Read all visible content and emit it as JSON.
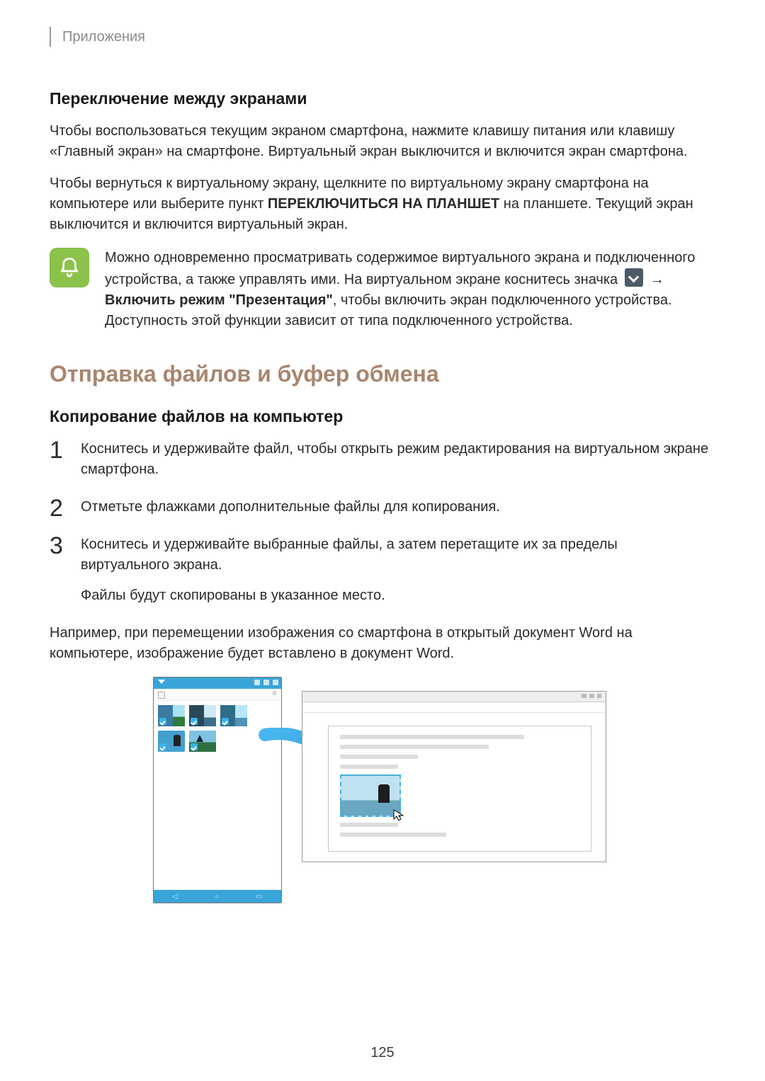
{
  "header": {
    "label": "Приложения"
  },
  "section1": {
    "title": "Переключение между экранами",
    "p1": "Чтобы воспользоваться текущим экраном смартфона, нажмите клавишу питания или клавишу «Главный экран» на смартфоне. Виртуальный экран выключится и включится экран смартфона.",
    "p2_a": "Чтобы вернуться к виртуальному экрану, щелкните по виртуальному экрану смартфона на компьютере или выберите пункт ",
    "p2_bold": "ПЕРЕКЛЮЧИТЬСЯ НА ПЛАНШЕТ",
    "p2_b": " на планшете. Текущий экран выключится и включится виртуальный экран."
  },
  "note": {
    "line1_a": "Можно одновременно просматривать содержимое виртуального экрана и подключенного устройства, а также управлять ими. На виртуальном экране коснитесь значка ",
    "line1_arrow": "→",
    "line2_bold": "Включить режим \"Презентация\"",
    "line2_rest": ", чтобы включить экран подключенного устройства. Доступность этой функции зависит от типа подключенного устройства."
  },
  "topic": {
    "title": "Отправка файлов и буфер обмена",
    "subtitle": "Копирование файлов на компьютер",
    "steps": {
      "s1": "Коснитесь и удерживайте файл, чтобы открыть режим редактирования на виртуальном экране смартфона.",
      "s2": "Отметьте флажками дополнительные файлы для копирования.",
      "s3_a": "Коснитесь и удерживайте выбранные файлы, а затем перетащите их за пределы виртуального экрана.",
      "s3_b": "Файлы будут скопированы в указанное место."
    },
    "example": "Например, при перемещении изображения со смартфона в открытый документ Word на компьютере, изображение будет вставлено в документ Word."
  },
  "page_number": "125"
}
